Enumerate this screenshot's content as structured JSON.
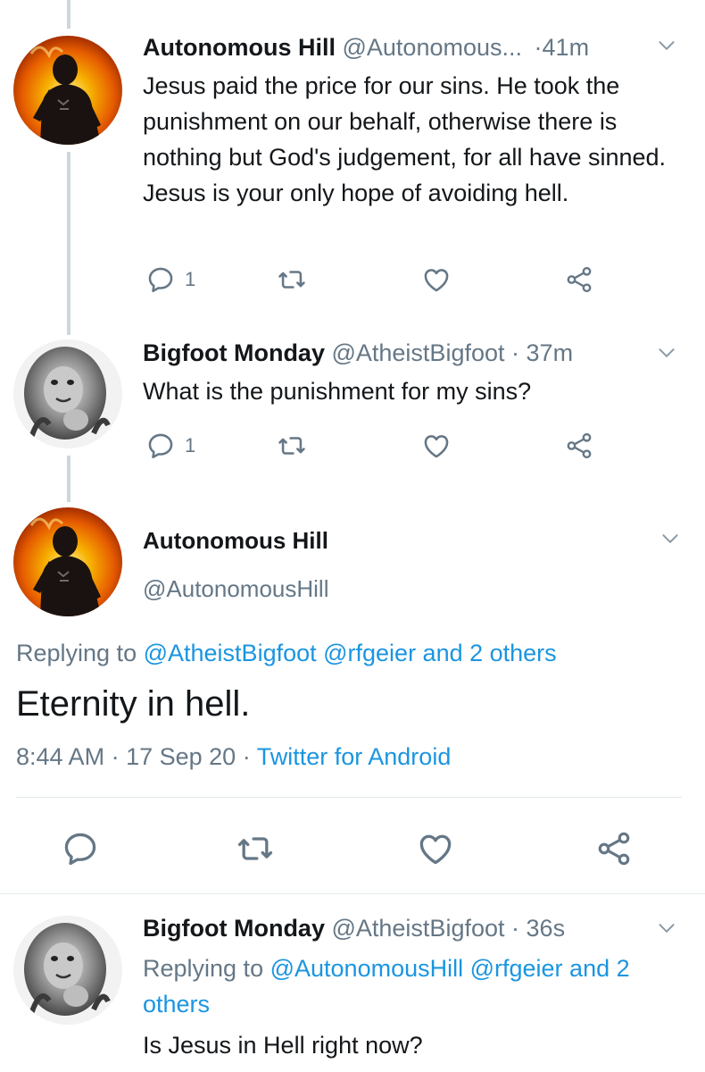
{
  "tweet1": {
    "name": "Autonomous Hill",
    "handle": "@Autonomous...",
    "time": "41m",
    "text": "Jesus paid the price for our sins. He took the punishment on our behalf, otherwise there is nothing but God's judgement, for all have sinned. Jesus is your only hope of avoiding hell.",
    "reply_count": "1"
  },
  "tweet2": {
    "name": "Bigfoot Monday",
    "handle": "@AtheistBigfoot",
    "time": "37m",
    "text": "What is the punishment for my sins?",
    "reply_count": "1"
  },
  "main_tweet": {
    "name": "Autonomous Hill",
    "handle": "@AutonomousHill",
    "replying_prefix": "Replying to",
    "replying_links": "@AtheistBigfoot @rfgeier and 2 others",
    "text": "Eternity in hell.",
    "time": "8:44 AM",
    "date": "17 Sep 20",
    "source": "Twitter for Android"
  },
  "tweet4": {
    "name": "Bigfoot Monday",
    "handle": "@AtheistBigfoot",
    "time": "36s",
    "replying_prefix": "Replying to",
    "replying_links_line1": "@AutonomousHill @rfgeier and 2",
    "replying_links_line2": "others",
    "text": "Is Jesus in Hell right now?"
  },
  "separator": "·",
  "icons": [
    "reply-icon",
    "retweet-icon",
    "like-icon",
    "share-icon",
    "chevron-down-icon"
  ],
  "colors": {
    "link": "#1b95e0",
    "muted": "#657786",
    "text": "#14171a",
    "thread_line": "#ccd6dd"
  }
}
